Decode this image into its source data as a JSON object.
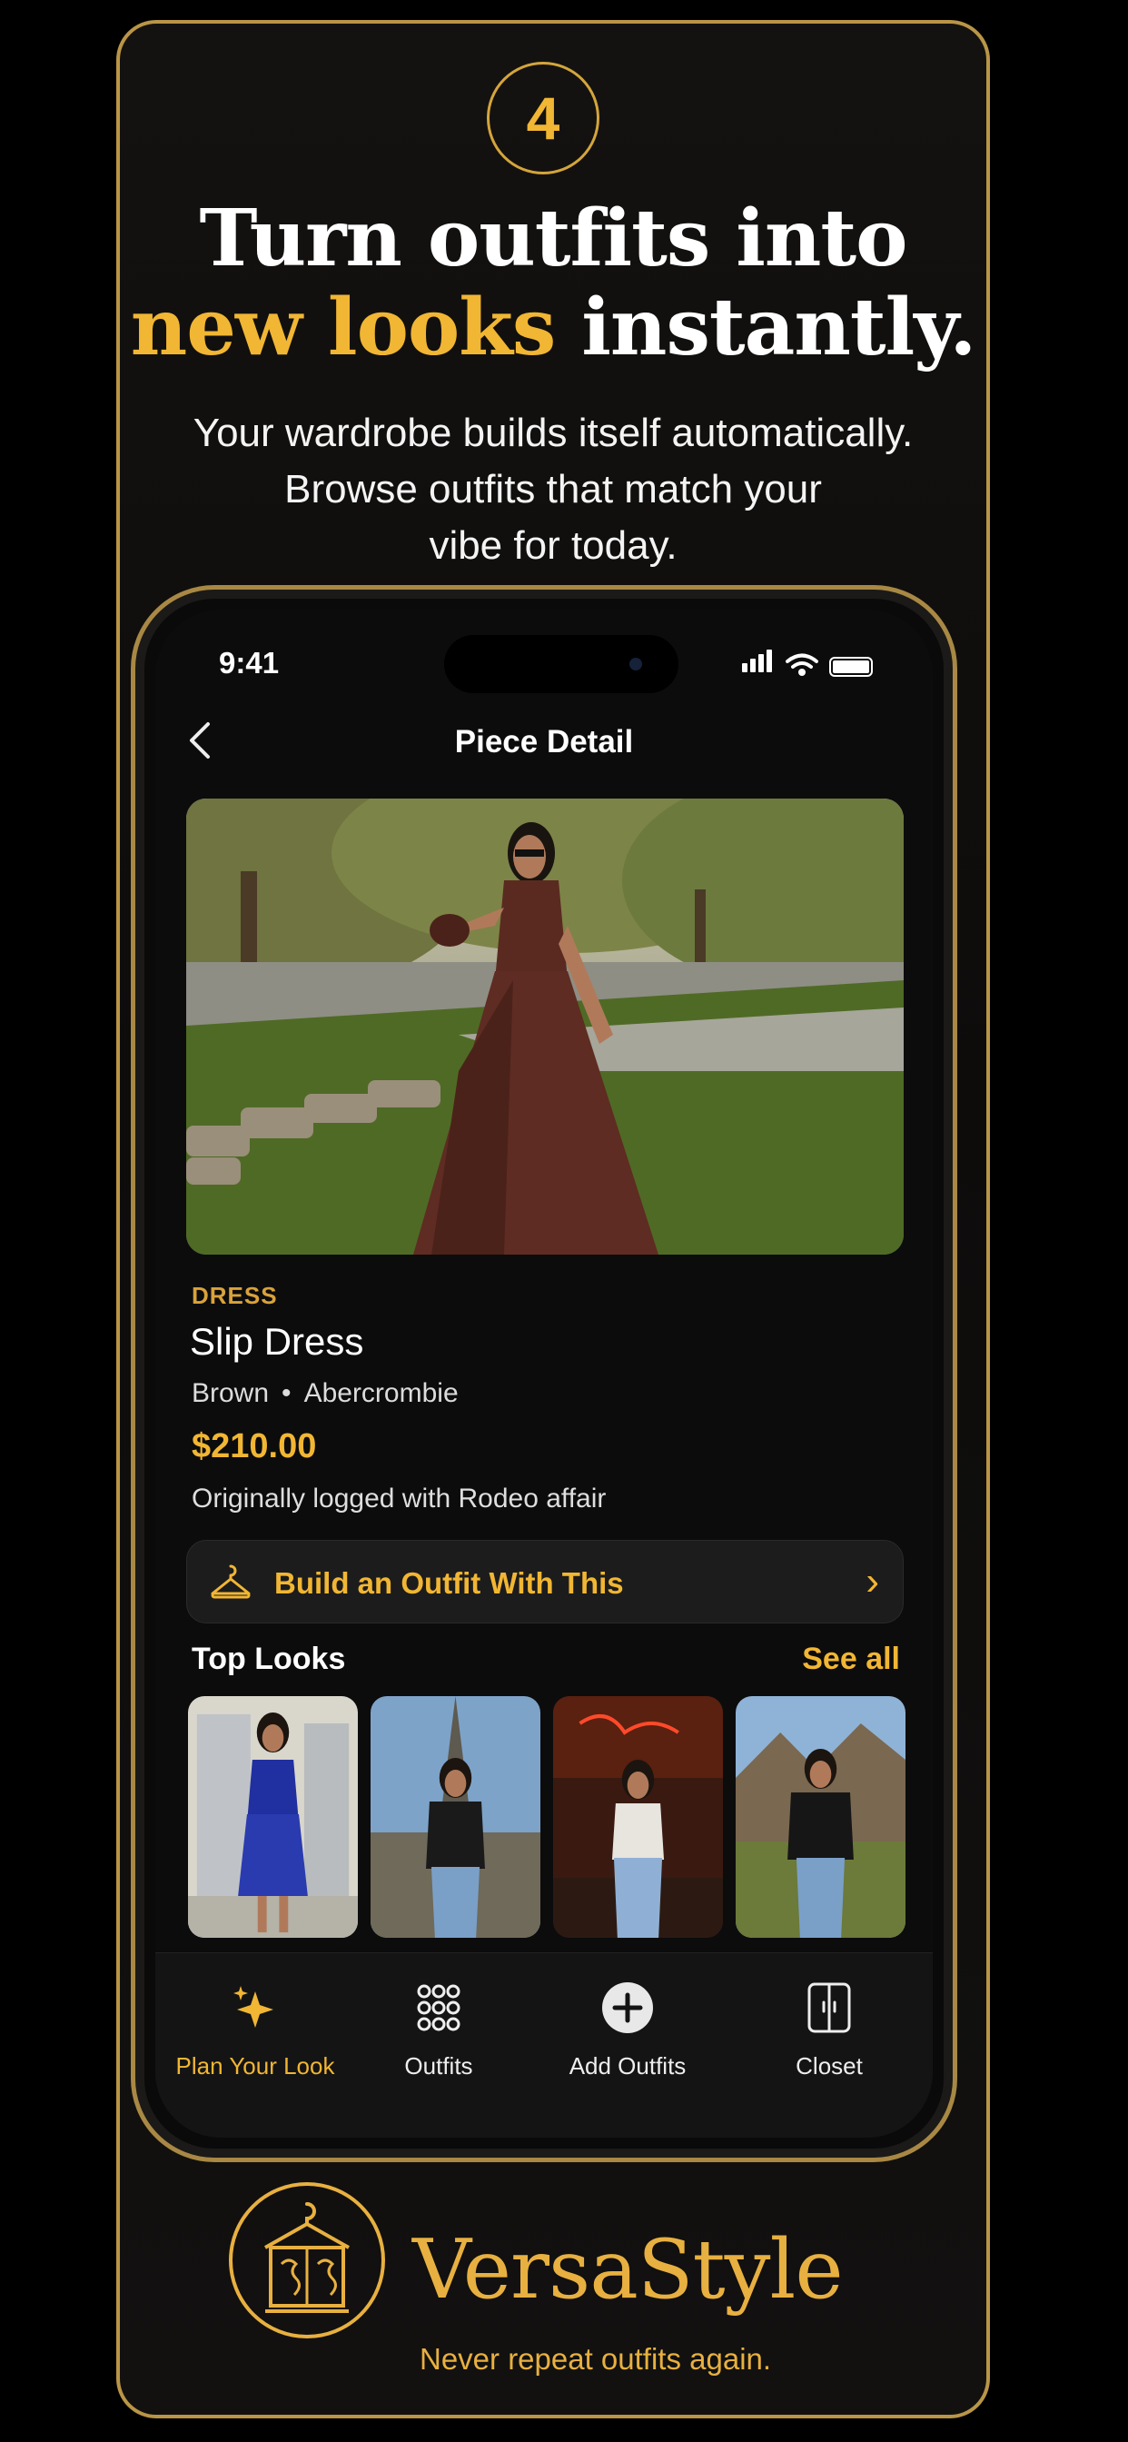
{
  "promo": {
    "step_number": "4",
    "headline_line1": "Turn outfits into",
    "headline_gold": "new looks",
    "headline_rest": "instantly.",
    "subtext_line1": "Your wardrobe builds itself automatically.",
    "subtext_line2": "Browse outfits that match your",
    "subtext_line3": "vibe for today."
  },
  "status_bar": {
    "time": "9:41"
  },
  "nav": {
    "title": "Piece Detail",
    "back_icon": "chevron-left-icon"
  },
  "piece": {
    "category": "DRESS",
    "name": "Slip Dress",
    "color": "Brown",
    "separator": "•",
    "brand": "Abercrombie",
    "price": "$210.00",
    "origin_note": "Originally logged with Rodeo affair"
  },
  "build_button": {
    "label": "Build an Outfit With This",
    "icon": "hanger-icon"
  },
  "top_looks": {
    "title": "Top Looks",
    "see_all": "See all",
    "items": [
      "blue dress look",
      "paris look",
      "neon cafe look",
      "mountain look"
    ]
  },
  "tabbar": {
    "tabs": [
      {
        "label": "Plan Your Look",
        "icon": "sparkles-icon",
        "active": true
      },
      {
        "label": "Outfits",
        "icon": "grid-icon",
        "active": false
      },
      {
        "label": "Add Outfits",
        "icon": "plus-circle-icon",
        "active": false
      },
      {
        "label": "Closet",
        "icon": "closet-icon",
        "active": false
      }
    ]
  },
  "brand": {
    "name": "VersaStyle",
    "tagline": "Never repeat outfits again."
  },
  "colors": {
    "gold": "#f1b633",
    "border_gold": "#b99546",
    "background": "#0d0c0b"
  }
}
